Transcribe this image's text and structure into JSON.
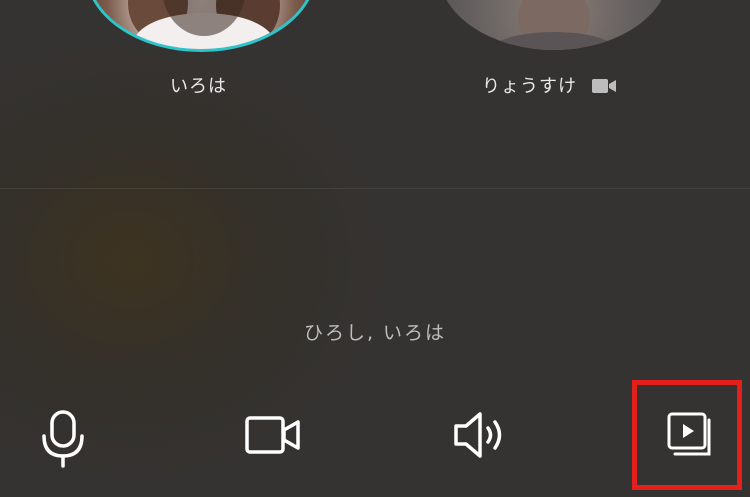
{
  "participants": [
    {
      "name": "いろは",
      "camera_icon": ""
    },
    {
      "name": "りょうすけ",
      "camera_icon": "video-camera-icon"
    }
  ],
  "voice": {
    "speakers_text": "ひろし, いろは",
    "wave_colors": [
      "#4aa3df",
      "#2fd07a"
    ]
  },
  "toolbar": {
    "items": [
      {
        "name": "microphone",
        "icon": "microphone-icon"
      },
      {
        "name": "camera",
        "icon": "video-camera-icon"
      },
      {
        "name": "speaker",
        "icon": "speaker-icon"
      },
      {
        "name": "share-media",
        "icon": "media-play-stack-icon",
        "highlighted": true
      }
    ],
    "highlight_color": "#e3201b"
  },
  "colors": {
    "avatar_ring": "#2ec4c9",
    "text": "#e8e8e8",
    "secondary_text": "#bdbdbd"
  }
}
